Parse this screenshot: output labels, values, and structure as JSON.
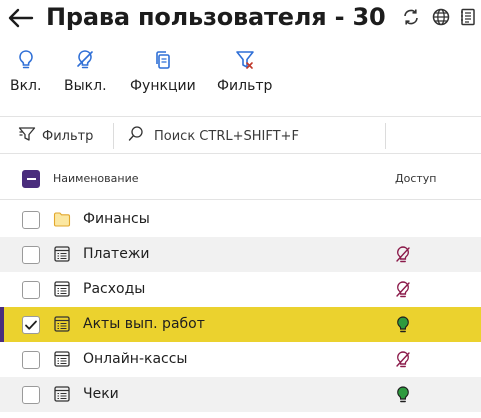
{
  "header": {
    "title": "Права пользователя - 30",
    "icons": [
      "refresh-icon",
      "globe-icon",
      "notes-icon"
    ]
  },
  "toolbar": {
    "on_label": "Вкл.",
    "off_label": "Выкл.",
    "functions_label": "Функции",
    "filter_label": "Фильтр"
  },
  "searchbar": {
    "filter_label": "Фильтр",
    "search_placeholder": "Поиск CTRL+SHIFT+F"
  },
  "table": {
    "col_name": "Наименование",
    "col_access": "Доступ",
    "rows": [
      {
        "label": "Финансы",
        "icon": "folder-icon",
        "access": "none",
        "checked": false
      },
      {
        "label": "Платежи",
        "icon": "document-list-icon",
        "access": "off",
        "checked": false
      },
      {
        "label": "Расходы",
        "icon": "document-list-icon",
        "access": "off",
        "checked": false
      },
      {
        "label": "Акты вып. работ",
        "icon": "document-list-icon",
        "access": "on",
        "checked": true
      },
      {
        "label": "Онлайн-кассы",
        "icon": "document-list-icon",
        "access": "off",
        "checked": false
      },
      {
        "label": "Чеки",
        "icon": "document-list-icon",
        "access": "on",
        "checked": false
      }
    ]
  },
  "colors": {
    "accent": "#4a2d7d",
    "selected_row": "#ebd22e",
    "icon_blue": "#2f6fd6",
    "access_off": "#8b1a4a",
    "access_on": "#2e9a3e"
  }
}
